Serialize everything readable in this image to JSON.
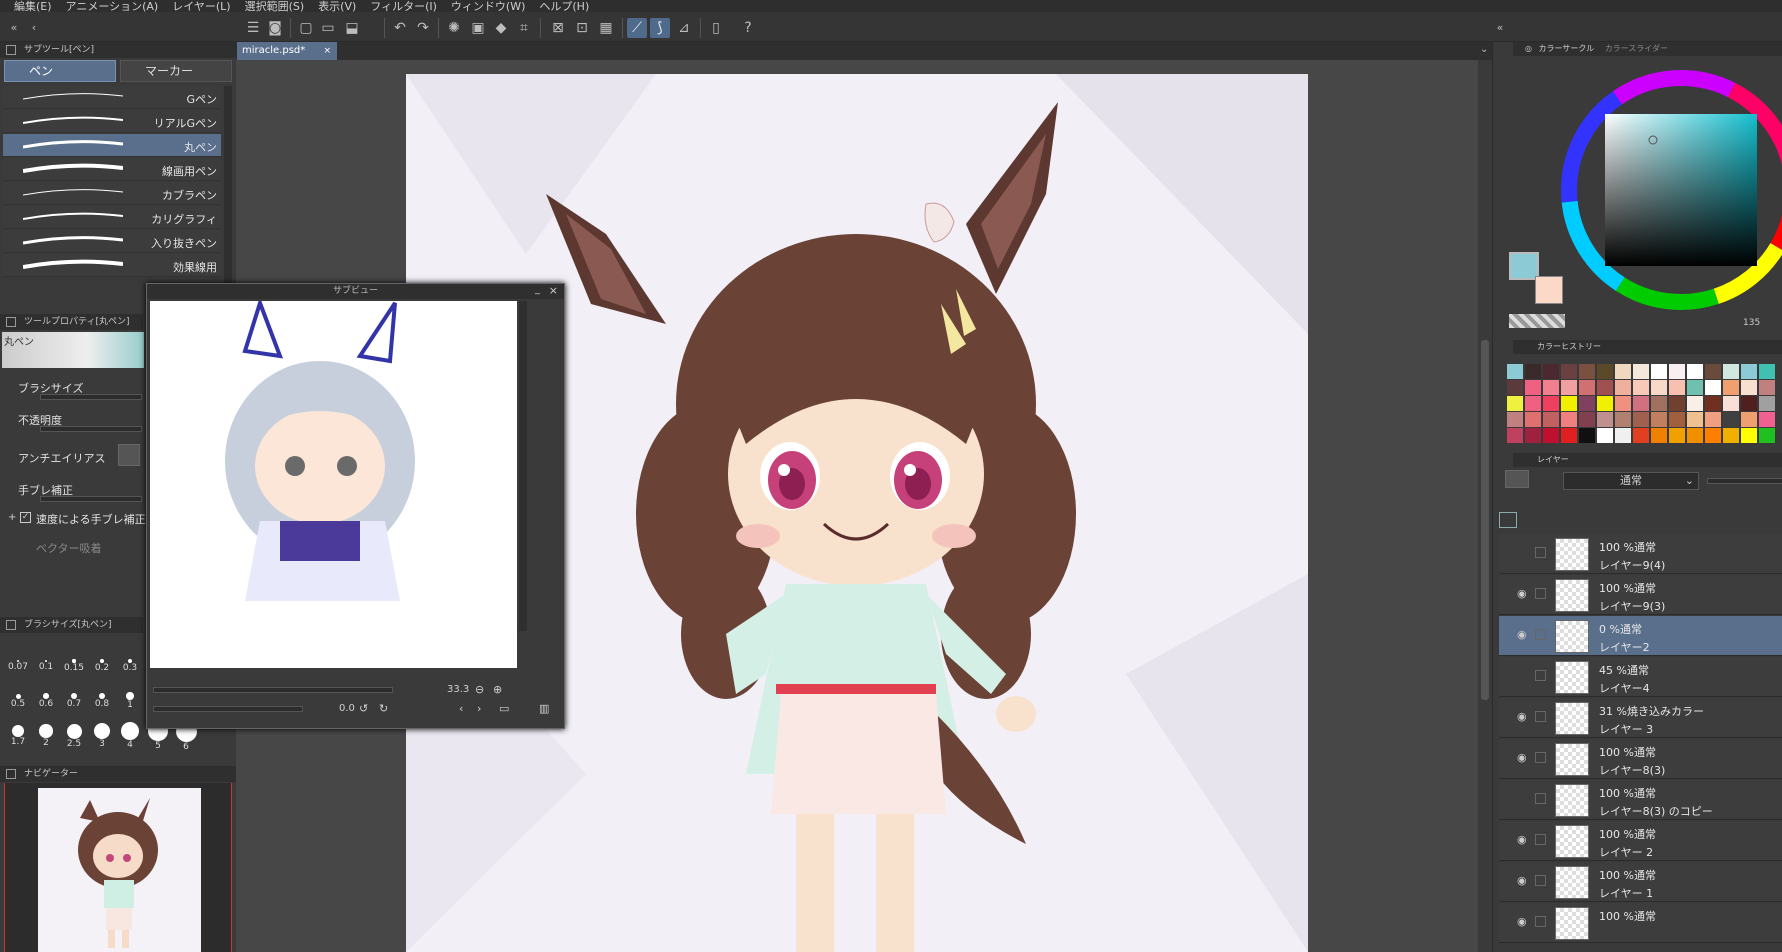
{
  "menu": [
    "編集(E)",
    "アニメーション(A)",
    "レイヤー(L)",
    "選択範囲(S)",
    "表示(V)",
    "フィルター(I)",
    "ウィンドウ(W)",
    "ヘルプ(H)"
  ],
  "document": {
    "tab": "miracle.psd*"
  },
  "subtool": {
    "header": "サブツール[ペン]",
    "tabs": [
      "ペン",
      "マーカー"
    ],
    "brushes": [
      "Gペン",
      "リアルGペン",
      "丸ペン",
      "線画用ペン",
      "カブラペン",
      "カリグラフィ",
      "入り抜きペン",
      "効果線用"
    ],
    "selected": 2
  },
  "tool_property": {
    "header": "ツールプロパティ[丸ペン]",
    "preset": "丸ペン",
    "items": [
      "ブラシサイズ",
      "不透明度",
      "アンチエイリアス",
      "手ブレ補正",
      "速度による手ブレ補正",
      "ベクター吸着"
    ]
  },
  "brush_size": {
    "header": "ブラシサイズ[丸ペン]",
    "row1": [
      "0.07",
      "0.1",
      "0.15",
      "0.2",
      "0.3"
    ],
    "row2": [
      "0.5",
      "0.6",
      "0.7",
      "0.8",
      "1"
    ],
    "row3": [
      "1.7",
      "2",
      "2.5",
      "3",
      "4",
      "5",
      "6"
    ]
  },
  "navigator": {
    "header": "ナビゲーター"
  },
  "subview": {
    "title": "サブビュー",
    "zoom": "33.3",
    "rotation": "0.0"
  },
  "color": {
    "tabs": [
      "カラーサークル",
      "カラースライダー"
    ],
    "main": "#8ccad6",
    "sub": "#fbd8c8",
    "value": "135"
  },
  "history": {
    "header": "カラーヒストリー",
    "swatches": [
      "#8ccad6",
      "#3a2a2a",
      "#4a2a30",
      "#6b4040",
      "#7a5040",
      "#5a4a2a",
      "#f0d8c0",
      "#f4e8dc",
      "#ffffff",
      "#f8f0f0",
      "#ffffff",
      "#6a4a3a",
      "#d0e8e0",
      "#8ccad6",
      "#40c0b0",
      "#5a3a3a",
      "#f06080",
      "#f08090",
      "#f0a0a0",
      "#d07070",
      "#a05050",
      "#f0b0a0",
      "#f8c8b8",
      "#f8d8c8",
      "#f8c0b0",
      "#70c0b0",
      "#ffffff",
      "#f0a070",
      "#f8e0d0",
      "#c08080",
      "#f0f040",
      "#f06080",
      "#f04060",
      "#f0f000",
      "#804060",
      "#f0f000",
      "#f09080",
      "#d07080",
      "#a07060",
      "#704030",
      "#f8f0e8",
      "#703020",
      "#f8e0d8",
      "#502020",
      "#a0a0a0",
      "#c08080",
      "#e07070",
      "#c06060",
      "#f08080",
      "#804050",
      "#c09090",
      "#b08070",
      "#a06050",
      "#c08060",
      "#a06040",
      "#f0c090",
      "#f0a080",
      "#404040",
      "#f0a070",
      "#f06090",
      "#c04060",
      "#a02040",
      "#c01030",
      "#e02020",
      "#101010",
      "#ffffff",
      "#f0f0f0",
      "#e04020",
      "#f08000",
      "#f0a000",
      "#f09000",
      "#ff8000",
      "#f0b000",
      "#ffff00",
      "#20c020"
    ]
  },
  "layers": {
    "header": "レイヤー",
    "blend": "通常",
    "rows": [
      {
        "l1": "100 %通常",
        "l2": "レイヤー9(4)",
        "eye": false
      },
      {
        "l1": "100 %通常",
        "l2": "レイヤー9(3)",
        "eye": true
      },
      {
        "l1": "0 %通常",
        "l2": "レイヤー2",
        "eye": true,
        "sel": true
      },
      {
        "l1": "45 %通常",
        "l2": "レイヤー4",
        "eye": false
      },
      {
        "l1": "31 %焼き込みカラー",
        "l2": "レイヤー 3",
        "eye": true
      },
      {
        "l1": "100 %通常",
        "l2": "レイヤー8(3)",
        "eye": true
      },
      {
        "l1": "100 %通常",
        "l2": "レイヤー8(3) のコピー",
        "eye": false
      },
      {
        "l1": "100 %通常",
        "l2": "レイヤー 2",
        "eye": true
      },
      {
        "l1": "100 %通常",
        "l2": "レイヤー 1",
        "eye": true
      },
      {
        "l1": "100 %通常",
        "l2": "",
        "eye": true
      }
    ]
  }
}
